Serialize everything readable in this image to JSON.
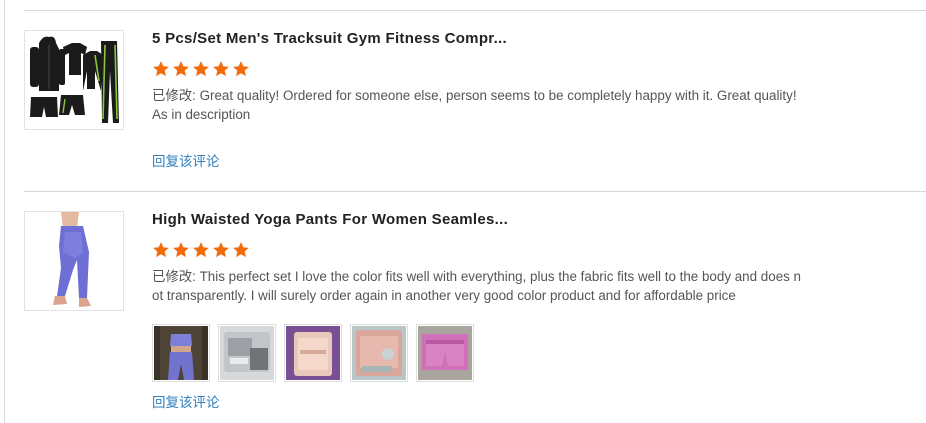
{
  "reviews": [
    {
      "title": "5 Pcs/Set Men's Tracksuit Gym Fitness Compr...",
      "rating": 5,
      "text": "已修改: Great quality! Ordered for someone else, person seems to be completely happy with it. Great quality! As in description",
      "reply_label": "回复该评论",
      "product_icon": "tracksuit-set-icon",
      "photos": []
    },
    {
      "title": "High Waisted Yoga Pants For Women Seamles...",
      "rating": 5,
      "text": "已修改: This perfect set I love the color fits well with everything, plus the fabric fits well to the body and does not transparently. I will surely order again in another very good color product and for affordable price",
      "reply_label": "回复该评论",
      "product_icon": "yoga-pants-icon",
      "photos": [
        "photo-set-worn",
        "photo-package-grey",
        "photo-package-purple",
        "photo-package-pink",
        "photo-pink-shorts"
      ]
    }
  ],
  "colors": {
    "star": "#f26c0d",
    "reply_link": "#2d7fc0",
    "divider": "#d7d7d7"
  }
}
